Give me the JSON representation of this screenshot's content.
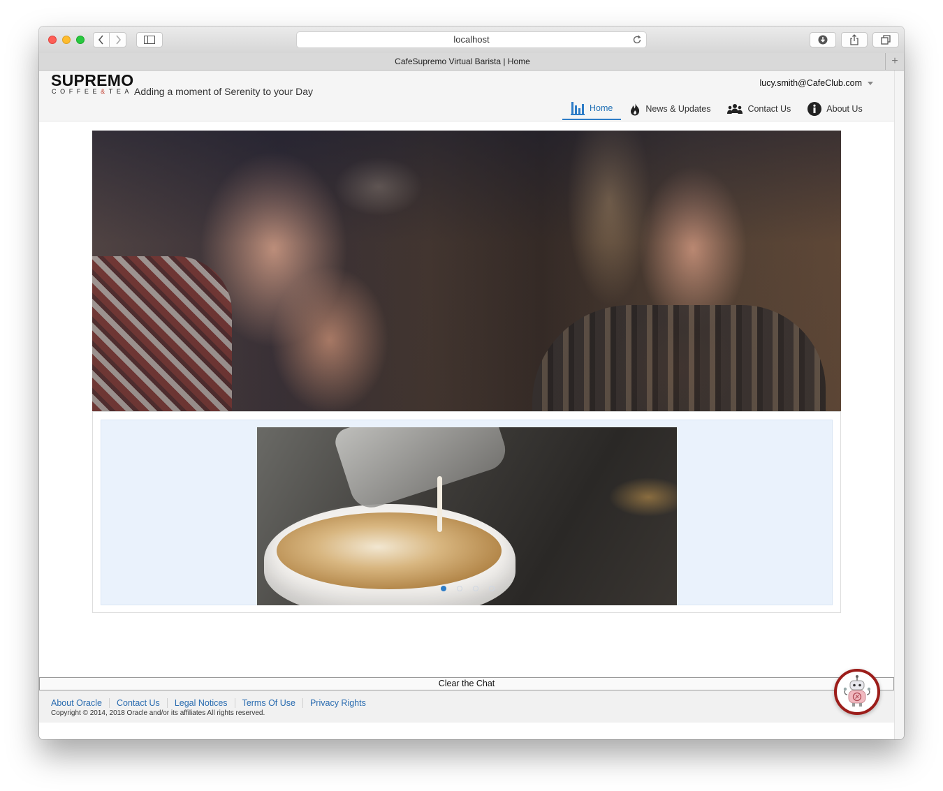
{
  "browser": {
    "url": "localhost",
    "tab_title": "CafeSupremo Virtual Barista | Home"
  },
  "header": {
    "logo_main": "SUPREMO",
    "logo_sub_a": "COFFEE",
    "logo_sub_amp": "&",
    "logo_sub_b": "TEA",
    "tagline": "Adding a moment of Serenity to your Day",
    "user_email": "lucy.smith@CafeClub.com"
  },
  "nav": {
    "items": [
      {
        "label": "Home",
        "icon": "bar-chart-icon",
        "active": true
      },
      {
        "label": "News & Updates",
        "icon": "fire-icon",
        "active": false
      },
      {
        "label": "Contact Us",
        "icon": "people-icon",
        "active": false
      },
      {
        "label": "About Us",
        "icon": "info-icon",
        "active": false
      }
    ]
  },
  "carousel": {
    "slide_count": 4,
    "active_index": 0
  },
  "chat": {
    "clear_label": "Clear the Chat"
  },
  "footer": {
    "links": [
      "About Oracle",
      "Contact Us",
      "Legal Notices",
      "Terms Of Use",
      "Privacy Rights"
    ],
    "copyright": "Copyright © 2014, 2018 Oracle and/or its affiliates All rights reserved."
  },
  "colors": {
    "accent": "#2d7cc7",
    "link": "#2a6cb0",
    "carousel_bg": "#eaf2fc",
    "chatbot_ring": "#9c1d1a"
  }
}
